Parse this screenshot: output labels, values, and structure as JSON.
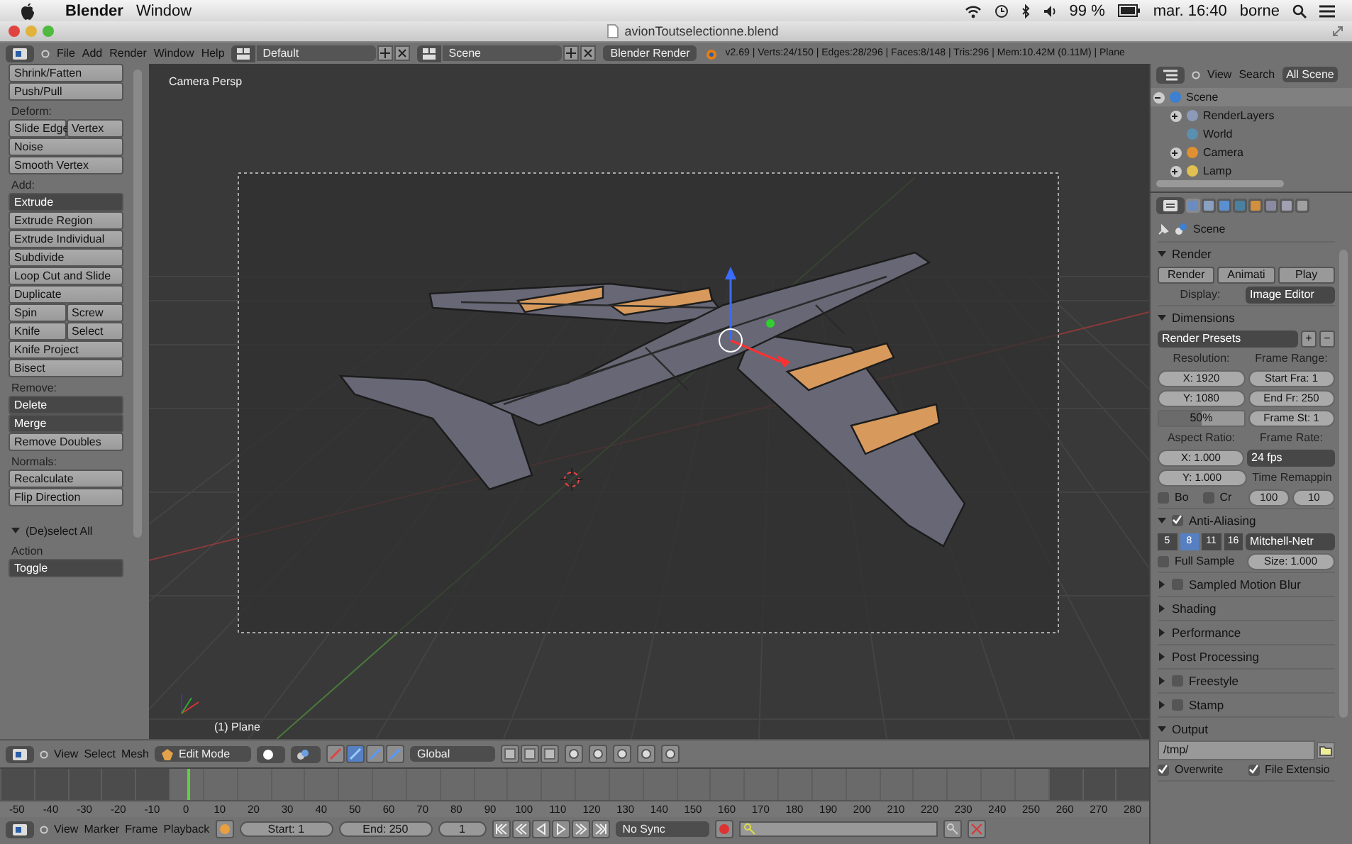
{
  "menubar": {
    "app": "Blender",
    "menus": [
      "Window"
    ],
    "battery": "99 %",
    "clock": "mar. 16:40",
    "user": "borne"
  },
  "window": {
    "title": "avionToutselectionne.blend"
  },
  "info_header": {
    "menus": [
      "File",
      "Add",
      "Render",
      "Window",
      "Help"
    ],
    "layout": "Default",
    "scene": "Scene",
    "engine": "Blender Render",
    "stats": "v2.69 | Verts:24/150 | Edges:28/296 | Faces:8/148 | Tris:296 | Mem:10.42M (0.11M) | Plane"
  },
  "tool_shelf": {
    "items": [
      {
        "kind": "button",
        "label": "Shrink/Fatten"
      },
      {
        "kind": "button",
        "label": "Push/Pull"
      },
      {
        "kind": "heading",
        "label": "Deform:"
      },
      {
        "kind": "pair",
        "labels": [
          "Slide Edge",
          "Vertex"
        ]
      },
      {
        "kind": "button",
        "label": "Noise"
      },
      {
        "kind": "button",
        "label": "Smooth Vertex"
      },
      {
        "kind": "heading",
        "label": "Add:"
      },
      {
        "kind": "dropdown",
        "label": "Extrude"
      },
      {
        "kind": "button",
        "label": "Extrude Region"
      },
      {
        "kind": "button",
        "label": "Extrude Individual"
      },
      {
        "kind": "button",
        "label": "Subdivide"
      },
      {
        "kind": "button",
        "label": "Loop Cut and Slide"
      },
      {
        "kind": "button",
        "label": "Duplicate"
      },
      {
        "kind": "pair",
        "labels": [
          "Spin",
          "Screw"
        ]
      },
      {
        "kind": "pair",
        "labels": [
          "Knife",
          "Select"
        ]
      },
      {
        "kind": "button",
        "label": "Knife Project"
      },
      {
        "kind": "button",
        "label": "Bisect"
      },
      {
        "kind": "heading",
        "label": "Remove:"
      },
      {
        "kind": "dropdown",
        "label": "Delete"
      },
      {
        "kind": "dropdown",
        "label": "Merge"
      },
      {
        "kind": "button",
        "label": "Remove Doubles"
      },
      {
        "kind": "heading",
        "label": "Normals:"
      },
      {
        "kind": "button",
        "label": "Recalculate"
      },
      {
        "kind": "button",
        "label": "Flip Direction"
      }
    ],
    "operator": {
      "title": "(De)select All",
      "expanded": true,
      "field_label": "Action",
      "value": "Toggle"
    }
  },
  "viewport": {
    "view_name": "Camera Persp",
    "object": "(1) Plane"
  },
  "viewport_header": {
    "menus": [
      "View",
      "Select",
      "Mesh"
    ],
    "mode": "Edit Mode",
    "orientation": "Global"
  },
  "timeline": {
    "ticks": [
      {
        "label": "-50",
        "in_range": false,
        "current": false
      },
      {
        "label": "-40",
        "in_range": false,
        "current": false
      },
      {
        "label": "-30",
        "in_range": false,
        "current": false
      },
      {
        "label": "-20",
        "in_range": false,
        "current": false
      },
      {
        "label": "-10",
        "in_range": false,
        "current": false
      },
      {
        "label": "0",
        "in_range": true,
        "current": true
      },
      {
        "label": "10",
        "in_range": true,
        "current": false
      },
      {
        "label": "20",
        "in_range": true,
        "current": false
      },
      {
        "label": "30",
        "in_range": true,
        "current": false
      },
      {
        "label": "40",
        "in_range": true,
        "current": false
      },
      {
        "label": "50",
        "in_range": true,
        "current": false
      },
      {
        "label": "60",
        "in_range": true,
        "current": false
      },
      {
        "label": "70",
        "in_range": true,
        "current": false
      },
      {
        "label": "80",
        "in_range": true,
        "current": false
      },
      {
        "label": "90",
        "in_range": true,
        "current": false
      },
      {
        "label": "100",
        "in_range": true,
        "current": false
      },
      {
        "label": "110",
        "in_range": true,
        "current": false
      },
      {
        "label": "120",
        "in_range": true,
        "current": false
      },
      {
        "label": "130",
        "in_range": true,
        "current": false
      },
      {
        "label": "140",
        "in_range": true,
        "current": false
      },
      {
        "label": "150",
        "in_range": true,
        "current": false
      },
      {
        "label": "160",
        "in_range": true,
        "current": false
      },
      {
        "label": "170",
        "in_range": true,
        "current": false
      },
      {
        "label": "180",
        "in_range": true,
        "current": false
      },
      {
        "label": "190",
        "in_range": true,
        "current": false
      },
      {
        "label": "200",
        "in_range": true,
        "current": false
      },
      {
        "label": "210",
        "in_range": true,
        "current": false
      },
      {
        "label": "220",
        "in_range": true,
        "current": false
      },
      {
        "label": "230",
        "in_range": true,
        "current": false
      },
      {
        "label": "240",
        "in_range": true,
        "current": false
      },
      {
        "label": "250",
        "in_range": true,
        "current": false
      },
      {
        "label": "260",
        "in_range": false,
        "current": false
      },
      {
        "label": "270",
        "in_range": false,
        "current": false
      },
      {
        "label": "280",
        "in_range": false,
        "current": false
      }
    ]
  },
  "timeline_header": {
    "menus": [
      "View",
      "Marker",
      "Frame",
      "Playback"
    ],
    "start": "Start: 1",
    "end": "End: 250",
    "frame": "1",
    "sync": "No Sync"
  },
  "outliner": {
    "menus": [
      "View",
      "Search"
    ],
    "filter": "All Scene",
    "tree": [
      {
        "name": "Scene",
        "expanded": true,
        "children": [
          {
            "name": "RenderLayers",
            "expanded": false
          },
          {
            "name": "World"
          },
          {
            "name": "Camera",
            "expanded": false
          },
          {
            "name": "Lamp",
            "expanded": false
          }
        ]
      }
    ]
  },
  "properties": {
    "tabs": [
      {
        "selected": true
      },
      {
        "selected": false
      },
      {
        "selected": false
      },
      {
        "selected": false
      },
      {
        "selected": false
      },
      {
        "selected": false
      },
      {
        "selected": false
      },
      {
        "selected": false
      }
    ],
    "context": "Scene",
    "panels": [
      {
        "title": "Render",
        "expanded": true,
        "rows": [
          [
            {
              "kind": "button",
              "label": "Render"
            },
            {
              "kind": "button",
              "label": "Animati"
            },
            {
              "kind": "button",
              "label": "Play"
            }
          ],
          [
            {
              "kind": "label",
              "label": "Display:"
            },
            {
              "kind": "dropdown",
              "label": "Image Editor"
            }
          ]
        ]
      },
      {
        "title": "Dimensions",
        "expanded": true,
        "rows": [
          [
            {
              "kind": "dropdown",
              "label": "Render Presets"
            },
            {
              "kind": "small",
              "label": "+"
            },
            {
              "kind": "small",
              "label": "−"
            }
          ],
          [
            {
              "kind": "label",
              "label": "Resolution:"
            },
            {
              "kind": "label",
              "label": "Frame Range:"
            }
          ],
          [
            {
              "kind": "field",
              "label": "X: 1920"
            },
            {
              "kind": "field",
              "label": "Start Fra: 1"
            }
          ],
          [
            {
              "kind": "field",
              "label": "Y: 1080"
            },
            {
              "kind": "field",
              "label": "End Fr: 250"
            }
          ],
          [
            {
              "kind": "slider",
              "label": "50%",
              "level": 0.5
            },
            {
              "kind": "field",
              "label": "Frame St: 1"
            }
          ],
          [
            {
              "kind": "label",
              "label": "Aspect Ratio:"
            },
            {
              "kind": "label",
              "label": "Frame Rate:"
            }
          ],
          [
            {
              "kind": "field",
              "label": "X: 1.000"
            },
            {
              "kind": "dropdown",
              "label": "24 fps"
            }
          ],
          [
            {
              "kind": "field",
              "label": "Y: 1.000"
            },
            {
              "kind": "label",
              "label": "Time Remappin"
            }
          ],
          [
            {
              "kind": "group",
              "items": [
                {
                  "kind": "checkbox",
                  "label": "Bo",
                  "checked": false
                },
                {
                  "kind": "checkbox",
                  "label": "Cr",
                  "checked": false
                }
              ]
            },
            {
              "kind": "group",
              "items": [
                {
                  "kind": "field",
                  "label": "100"
                },
                {
                  "kind": "field",
                  "label": "10"
                }
              ]
            }
          ]
        ]
      },
      {
        "title": "Anti-Aliasing",
        "expanded": true,
        "checkbox": true,
        "rows": [
          [
            {
              "kind": "group",
              "items": [
                {
                  "kind": "toggle",
                  "label": "5",
                  "selected": false
                },
                {
                  "kind": "toggle",
                  "label": "8",
                  "selected": true
                },
                {
                  "kind": "toggle",
                  "label": "11",
                  "selected": false
                },
                {
                  "kind": "toggle",
                  "label": "16",
                  "selected": false
                }
              ]
            },
            {
              "kind": "dropdown",
              "label": "Mitchell-Netr"
            }
          ],
          [
            {
              "kind": "checkbox",
              "label": "Full Sample",
              "checked": false
            },
            {
              "kind": "field",
              "label": "Size: 1.000"
            }
          ]
        ]
      },
      {
        "title": "Sampled Motion Blur",
        "expanded": false,
        "checkbox": false
      },
      {
        "title": "Shading",
        "expanded": false
      },
      {
        "title": "Performance",
        "expanded": false
      },
      {
        "title": "Post Processing",
        "expanded": false
      },
      {
        "title": "Freestyle",
        "expanded": false,
        "checkbox": false
      },
      {
        "title": "Stamp",
        "expanded": false,
        "checkbox": false
      },
      {
        "title": "Output",
        "expanded": true,
        "rows": [
          [
            {
              "kind": "path",
              "label": "/tmp/"
            }
          ],
          [
            {
              "kind": "checkbox",
              "label": "Overwrite",
              "checked": true
            },
            {
              "kind": "checkbox",
              "label": "File Extensio",
              "checked": true
            }
          ]
        ]
      }
    ]
  }
}
